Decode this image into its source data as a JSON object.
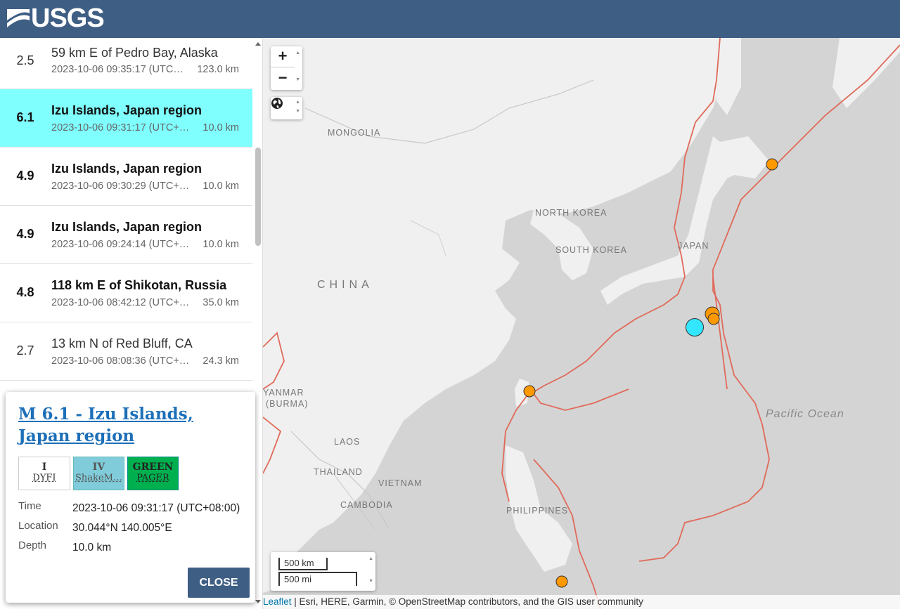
{
  "header": {
    "logo_text": "USGS",
    "logo_icon": "usgs-wave-mark"
  },
  "earthquakes": [
    {
      "mag": "2.5",
      "place": "59 km E of Pedro Bay, Alaska",
      "time": "2023-10-06 09:35:17 (UTC…",
      "depth": "123.0 km"
    },
    {
      "mag": "6.1",
      "place": "Izu Islands, Japan region",
      "time": "2023-10-06 09:31:17 (UTC+…",
      "depth": "10.0 km"
    },
    {
      "mag": "4.9",
      "place": "Izu Islands, Japan region",
      "time": "2023-10-06 09:30:29 (UTC+…",
      "depth": "10.0 km"
    },
    {
      "mag": "4.9",
      "place": "Izu Islands, Japan region",
      "time": "2023-10-06 09:24:14 (UTC+…",
      "depth": "10.0 km"
    },
    {
      "mag": "4.8",
      "place": "118 km E of Shikotan, Russia",
      "time": "2023-10-06 08:42:12 (UTC+…",
      "depth": "35.0 km"
    },
    {
      "mag": "2.7",
      "place": "13 km N of Red Bluff, CA",
      "time": "2023-10-06 08:08:36 (UTC+…",
      "depth": "24.3 km"
    }
  ],
  "map": {
    "labels": {
      "mongolia": "MONGOLIA",
      "north_korea": "NORTH KOREA",
      "south_korea": "SOUTH KOREA",
      "japan": "JAPAN",
      "china": "CHINA",
      "myanmar": "YANMAR\n(BURMA)",
      "myanmar_1": "YANMAR",
      "myanmar_2": "(BURMA)",
      "laos": "LAOS",
      "thailand": "THAILAND",
      "vietnam": "VIETNAM",
      "cambodia": "CAMBODIA",
      "philippines": "PHILIPPINES",
      "pacific": "Pacific Ocean"
    },
    "zoom_in": "+",
    "zoom_out": "−",
    "scale_km": "500 km",
    "scale_mi": "500 mi",
    "attribution_leaflet": "Leaflet",
    "attribution_rest": " | Esri, HERE, Garmin, © OpenStreetMap contributors, and the GIS user community",
    "colors": {
      "selected": "#33e6ff",
      "event": "#ff9900",
      "plate": "#e06a5a"
    }
  },
  "popup": {
    "title": "M 6.1 - Izu Islands, Japan region",
    "badges": {
      "dyfi_level": "I",
      "dyfi_label": "DYFI",
      "shake_level": "IV",
      "shake_label": "ShakeM…",
      "pager_level": "GREEN",
      "pager_label": "PAGER"
    },
    "time_label": "Time",
    "time_value": "2023-10-06 09:31:17 (UTC+08:00)",
    "location_label": "Location",
    "location_value": "30.044°N 140.005°E",
    "depth_label": "Depth",
    "depth_value": "10.0 km",
    "close_label": "CLOSE"
  }
}
